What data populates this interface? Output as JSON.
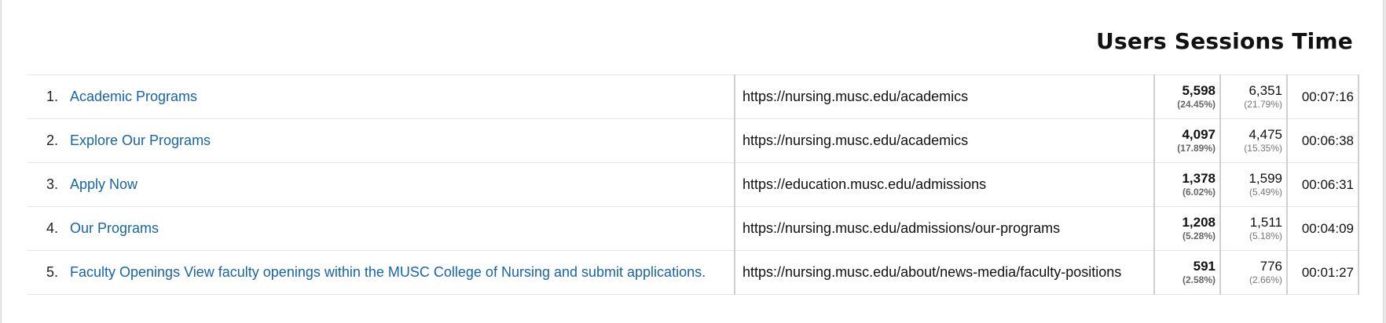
{
  "header": {
    "title": "Users Sessions Time"
  },
  "rows": [
    {
      "rank": "1.",
      "title": "Academic Programs",
      "url": "https://nursing.musc.edu/academics",
      "users": "5,598",
      "users_pct": "(24.45%)",
      "sessions": "6,351",
      "sessions_pct": "(21.79%)",
      "time": "00:07:16"
    },
    {
      "rank": "2.",
      "title": "Explore Our Programs",
      "url": "https://nursing.musc.edu/academics",
      "users": "4,097",
      "users_pct": "(17.89%)",
      "sessions": "4,475",
      "sessions_pct": "(15.35%)",
      "time": "00:06:38"
    },
    {
      "rank": "3.",
      "title": "Apply Now",
      "url": "https://education.musc.edu/admissions",
      "users": "1,378",
      "users_pct": "(6.02%)",
      "sessions": "1,599",
      "sessions_pct": "(5.49%)",
      "time": "00:06:31"
    },
    {
      "rank": "4.",
      "title": "Our Programs",
      "url": "https://nursing.musc.edu/admissions/our-programs",
      "users": "1,208",
      "users_pct": "(5.28%)",
      "sessions": "1,511",
      "sessions_pct": "(5.18%)",
      "time": "00:04:09"
    },
    {
      "rank": "5.",
      "title": "Faculty Openings View faculty openings within the MUSC College of Nursing and submit applications.",
      "url": "https://nursing.musc.edu/about/news-media/faculty-positions",
      "users": "591",
      "users_pct": "(2.58%)",
      "sessions": "776",
      "sessions_pct": "(2.66%)",
      "time": "00:01:27"
    }
  ]
}
